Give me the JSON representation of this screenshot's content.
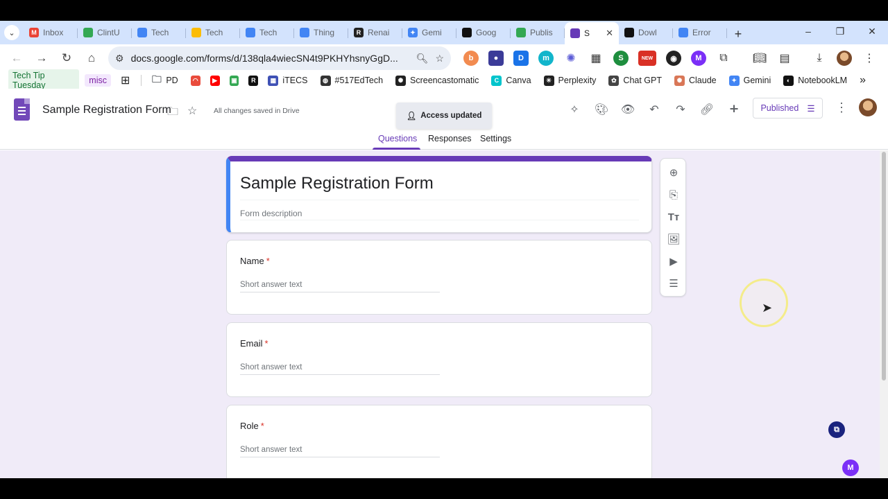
{
  "browser": {
    "tabs": [
      {
        "label": "Inbox",
        "color": "#ea4335",
        "glyph": "M"
      },
      {
        "label": "ClintU",
        "color": "#34a853",
        "glyph": ""
      },
      {
        "label": "Tech",
        "color": "#4285f4",
        "glyph": ""
      },
      {
        "label": "Tech",
        "color": "#fbbc04",
        "glyph": ""
      },
      {
        "label": "Tech",
        "color": "#4285f4",
        "glyph": ""
      },
      {
        "label": "Thing",
        "color": "#4285f4",
        "glyph": ""
      },
      {
        "label": "Renai",
        "color": "#222222",
        "glyph": "R"
      },
      {
        "label": "Gemi",
        "color": "#4285f4",
        "glyph": "✦"
      },
      {
        "label": "Goog",
        "color": "#111111",
        "glyph": ""
      },
      {
        "label": "Publis",
        "color": "#34a853",
        "glyph": ""
      },
      {
        "label": "S",
        "color": "#673ab7",
        "glyph": "",
        "active": true
      },
      {
        "label": "Dowl",
        "color": "#111111",
        "glyph": ""
      },
      {
        "label": "Error",
        "color": "#4285f4",
        "glyph": ""
      }
    ],
    "new_tab": "+",
    "url": "docs.google.com/forms/d/138qla4wiecSN4t9PKHYhsnyGgD...",
    "bookmarks": [
      {
        "label": "Tech Tip Tuesday",
        "type": "chip",
        "bg": "#e6f4ea",
        "color": "#137333"
      },
      {
        "label": "misc",
        "type": "chip",
        "bg": "#f3e8fd",
        "color": "#7b1fa2"
      },
      {
        "label": "PD",
        "icon": "folder-icon"
      },
      {
        "label": "iTECS",
        "icon": "itecs-icon"
      },
      {
        "label": "#517EdTech",
        "icon": "globe-icon"
      },
      {
        "label": "Screencastomatic",
        "icon": "screencastomatic-icon"
      },
      {
        "label": "Canva",
        "icon": "canva-icon"
      },
      {
        "label": "Perplexity",
        "icon": "perplexity-icon"
      },
      {
        "label": "Chat GPT",
        "icon": "chatgpt-icon"
      },
      {
        "label": "Claude",
        "icon": "claude-icon"
      },
      {
        "label": "Gemini",
        "icon": "gemini-icon"
      },
      {
        "label": "NotebookLM",
        "icon": "notebooklm-icon"
      }
    ],
    "extension_badge": "NEW"
  },
  "forms": {
    "doc_title": "Sample Registration Form",
    "saved_status": "All changes saved in Drive",
    "toast": "Access updated",
    "published_label": "Published",
    "tabs": [
      "Questions",
      "Responses",
      "Settings"
    ],
    "active_tab": "Questions",
    "accent_color": "#673ab7"
  },
  "form": {
    "title": "Sample Registration Form",
    "description_placeholder": "Form description",
    "questions": [
      {
        "label": "Name",
        "required": "*",
        "answer_placeholder": "Short answer text"
      },
      {
        "label": "Email",
        "required": "*",
        "answer_placeholder": "Short answer text"
      },
      {
        "label": "Role",
        "required": "*",
        "answer_placeholder": "Short answer text"
      }
    ]
  }
}
